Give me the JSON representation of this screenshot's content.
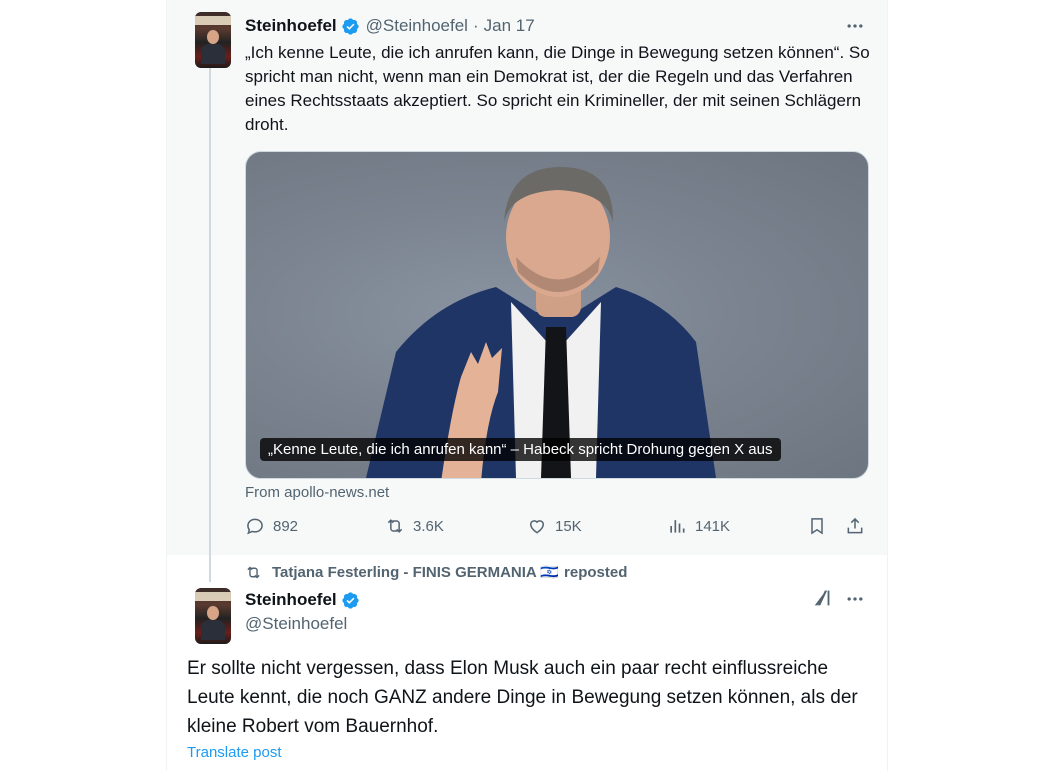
{
  "quoted_post": {
    "author_name": "Steinhoefel",
    "handle": "@Steinhoefel",
    "separator": "·",
    "date": "Jan 17",
    "text": "„Ich kenne Leute, die ich anrufen kann, die Dinge in Bewegung setzen können“. So spricht man nicht, wenn man ein Demokrat ist, der die Regeln und das Verfahren eines Rechtsstaats akzeptiert. So spricht ein Krimineller, der mit seinen Schlägern droht.",
    "media_caption": "„Kenne Leute, die ich anrufen kann“ – Habeck spricht Drohung gegen X aus",
    "source": "From apollo-news.net",
    "stats": {
      "replies": "892",
      "reposts": "3.6K",
      "likes": "15K",
      "views": "141K"
    }
  },
  "repost_banner": {
    "user": "Tatjana Festerling - FINIS GERMANIA 🇮🇱",
    "action": "reposted"
  },
  "main_post": {
    "author_name": "Steinhoefel",
    "handle": "@Steinhoefel",
    "text": "Er sollte nicht vergessen, dass Elon Musk auch ein paar recht einflussreiche Leute kennt, die noch GANZ andere Dinge in Bewegung setzen können, als der kleine Robert vom Bauernhof.",
    "translate_label": "Translate post"
  },
  "colors": {
    "accent": "#1d9bf0",
    "muted": "#536471",
    "text": "#0f1419",
    "quoted_bg": "#f7f9f9"
  },
  "icons": [
    "verified-badge-icon",
    "more-icon",
    "reply-icon",
    "repost-icon",
    "like-icon",
    "views-icon",
    "bookmark-icon",
    "share-icon",
    "grok-icon"
  ]
}
